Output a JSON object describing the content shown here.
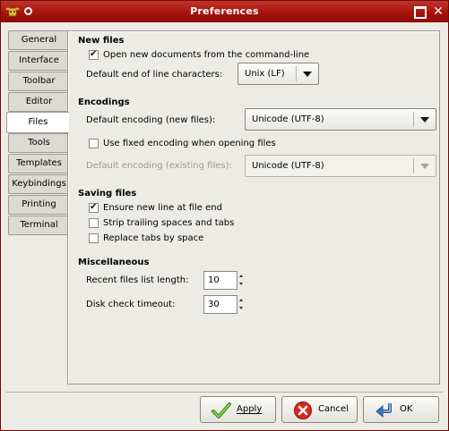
{
  "window": {
    "title": "Preferences"
  },
  "tabs": [
    {
      "label": "General"
    },
    {
      "label": "Interface"
    },
    {
      "label": "Toolbar"
    },
    {
      "label": "Editor"
    },
    {
      "label": "Files",
      "active": true
    },
    {
      "label": "Tools"
    },
    {
      "label": "Templates"
    },
    {
      "label": "Keybindings"
    },
    {
      "label": "Printing"
    },
    {
      "label": "Terminal"
    }
  ],
  "new_files": {
    "heading": "New files",
    "open_from_cmdline": {
      "label": "Open new documents from the command-line",
      "checked": true
    },
    "eol_label": "Default end of line characters:",
    "eol_value": "Unix (LF)"
  },
  "encodings": {
    "heading": "Encodings",
    "default_new_label": "Default encoding (new files):",
    "default_new_value": "Unicode (UTF-8)",
    "use_fixed": {
      "label": "Use fixed encoding when opening files",
      "checked": false
    },
    "default_existing_label": "Default encoding (existing files):",
    "default_existing_value": "Unicode (UTF-8)"
  },
  "saving": {
    "heading": "Saving files",
    "ensure_newline": {
      "label": "Ensure new line at file end",
      "checked": true
    },
    "strip_trailing": {
      "label": "Strip trailing spaces and tabs",
      "checked": false
    },
    "replace_tabs": {
      "label": "Replace tabs by space",
      "checked": false
    }
  },
  "misc": {
    "heading": "Miscellaneous",
    "recent_label": "Recent files list length:",
    "recent_value": "10",
    "disk_check_label": "Disk check timeout:",
    "disk_check_value": "30"
  },
  "buttons": {
    "apply": "Apply",
    "cancel": "Cancel",
    "ok": "OK"
  },
  "colors": {
    "titlebar": "#a8120c",
    "window_bg": "#ecebe5"
  }
}
